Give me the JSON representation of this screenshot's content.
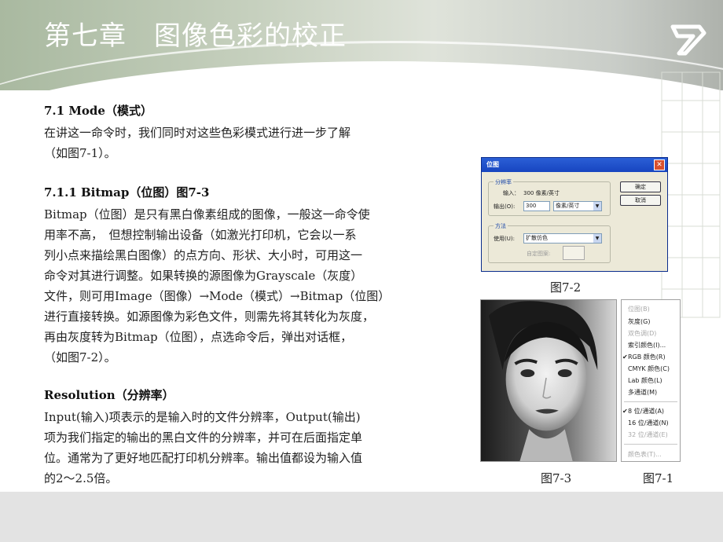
{
  "title": "第七章　图像色彩的校正",
  "content": {
    "h1": "7.1 Mode（模式）",
    "p1_l1": "在讲这一命令时，我们同时对这些色彩模式进行进一步了解",
    "p1_l2": "（如图7-1）。",
    "h2": "7.1.1 Bitmap（位图）图7-3",
    "p2_lines": [
      "Bitmap（位图）是只有黑白像素组成的图像，一般这一命令使",
      "用率不高，　但想控制输出设备（如激光打印机，它会以一系",
      "列小点来描绘黑白图像）的点方向、形状、大小时，可用这一",
      "命令对其进行调整。如果转换的源图像为Grayscale（灰度）",
      "文件，则可用Image（图像）→Mode（模式）→Bitmap（位图）",
      "进行直接转换。如源图像为彩色文件，则需先将其转化为灰度，",
      "再由灰度转为Bitmap（位图），点选命令后，弹出对话框，",
      "（如图7-2）。"
    ],
    "h3": "Resolution（分辨率）",
    "p3_lines": [
      "Input(输入)项表示的是输入时的文件分辨率，Output(输出)",
      "项为我们指定的输出的黑白文件的分辨率，并可在后面指定单",
      "位。通常为了更好地匹配打印机分辨率。输出值都设为输入值",
      "的2～2.5倍。"
    ]
  },
  "captions": {
    "fig2": "图7-2",
    "fig3": "图7-3",
    "fig1": "图7-1"
  },
  "dialog": {
    "title": "位图",
    "close": "✕",
    "res_group": "分辨率",
    "input_label": "输入：",
    "input_value": "300 像素/英寸",
    "output_label": "输出(O):",
    "output_value": "300",
    "unit": "像素/英寸",
    "method_group": "方法",
    "use_label": "使用(U):",
    "use_value": "扩散仿色",
    "pattern_label": "自定图案:",
    "ok": "确定",
    "cancel": "取消"
  },
  "menu": {
    "items": [
      {
        "label": "位图(B)",
        "disabled": true,
        "checked": false
      },
      {
        "label": "灰度(G)",
        "disabled": false,
        "checked": false
      },
      {
        "label": "双色调(D)",
        "disabled": true,
        "checked": false
      },
      {
        "label": "索引颜色(I)...",
        "disabled": false,
        "checked": false
      },
      {
        "label": "RGB 颜色(R)",
        "disabled": false,
        "checked": true
      },
      {
        "label": "CMYK 颜色(C)",
        "disabled": false,
        "checked": false
      },
      {
        "label": "Lab 颜色(L)",
        "disabled": false,
        "checked": false
      },
      {
        "label": "多通道(M)",
        "disabled": false,
        "checked": false
      },
      {
        "label": "8 位/通道(A)",
        "disabled": false,
        "checked": true
      },
      {
        "label": "16 位/通道(N)",
        "disabled": false,
        "checked": false
      },
      {
        "label": "32 位/通道(E)",
        "disabled": true,
        "checked": false
      },
      {
        "label": "颜色表(T)...",
        "disabled": true,
        "checked": false
      }
    ]
  }
}
